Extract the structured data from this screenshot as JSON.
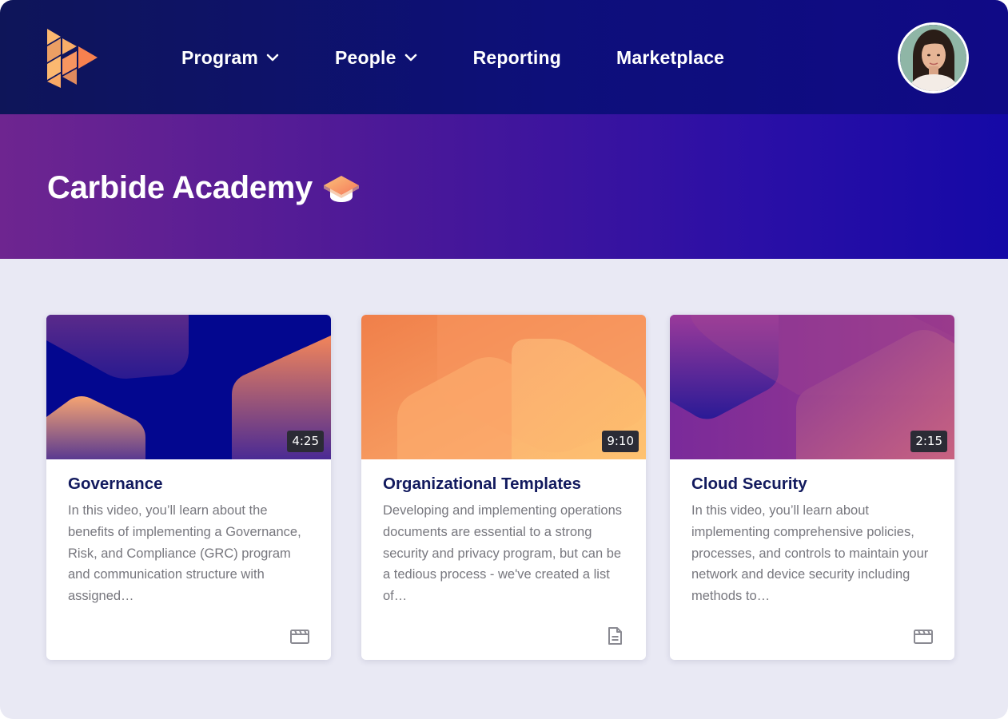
{
  "nav": {
    "logo_icon": "carbide-logo-icon",
    "items": [
      {
        "label": "Program",
        "has_dropdown": true
      },
      {
        "label": "People",
        "has_dropdown": true
      },
      {
        "label": "Reporting",
        "has_dropdown": false
      },
      {
        "label": "Marketplace",
        "has_dropdown": false
      }
    ],
    "avatar_icon": "user-avatar"
  },
  "hero": {
    "title": "Carbide Academy",
    "icon": "graduation-cap-icon"
  },
  "cards": [
    {
      "title": "Governance",
      "duration": "4:25",
      "description": "In this video, you’ll learn about the benefits of implementing a Governance, Risk, and Compliance (GRC) program and communication structure with assigned…",
      "type_icon": "video-clapperboard-icon"
    },
    {
      "title": "Organizational Templates",
      "duration": "9:10",
      "description": "Developing and implementing operations documents are essential to a strong security and privacy program, but can be a tedious process - we've created a list of…",
      "type_icon": "document-icon"
    },
    {
      "title": "Cloud Security",
      "duration": "2:15",
      "description": "In this video, you’ll learn about implementing comprehensive policies, processes, and controls to maintain your network and device security including methods to…",
      "type_icon": "video-clapperboard-icon"
    }
  ],
  "colors": {
    "nav_bg": "#0d0f7a",
    "hero_start": "#6e2590",
    "hero_end": "#1509a6",
    "page_bg": "#e9e9f4",
    "card_title": "#121a5e",
    "card_text": "#77777e",
    "accent_orange": "#f58a5a"
  }
}
